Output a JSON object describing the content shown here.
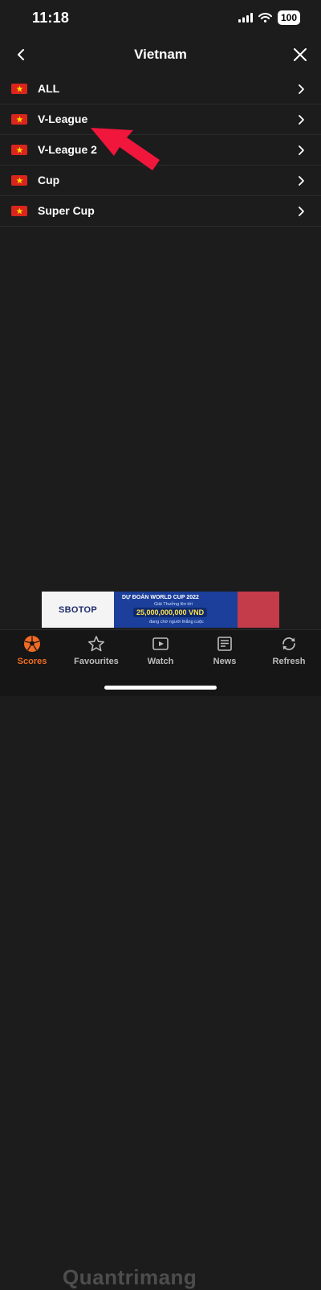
{
  "status_bar": {
    "time": "11:18",
    "battery": "100"
  },
  "nav": {
    "title": "Vietnam"
  },
  "leagues": [
    {
      "label": "ALL"
    },
    {
      "label": "V-League"
    },
    {
      "label": "V-League 2"
    },
    {
      "label": "Cup"
    },
    {
      "label": "Super Cup"
    }
  ],
  "ad": {
    "logo": "SBOTOP",
    "title": "DỰ ĐOÁN WORLD CUP 2022",
    "subtitle": "Giải Thưởng lên tới",
    "amount": "25,000,000,000 VND",
    "footer": "đang chờ người thắng cuộc"
  },
  "tabs": [
    {
      "label": "Scores",
      "icon": "soccer-ball-icon",
      "active": true
    },
    {
      "label": "Favourites",
      "icon": "star-icon",
      "active": false
    },
    {
      "label": "Watch",
      "icon": "video-icon",
      "active": false
    },
    {
      "label": "News",
      "icon": "newspaper-icon",
      "active": false
    },
    {
      "label": "Refresh",
      "icon": "refresh-icon",
      "active": false
    }
  ],
  "watermark": "Quantrimang",
  "colors": {
    "accent": "#f26b22",
    "background": "#1c1c1c",
    "flag_red": "#da251d",
    "flag_star": "#ffde00",
    "annotation_arrow": "#f0163c"
  }
}
